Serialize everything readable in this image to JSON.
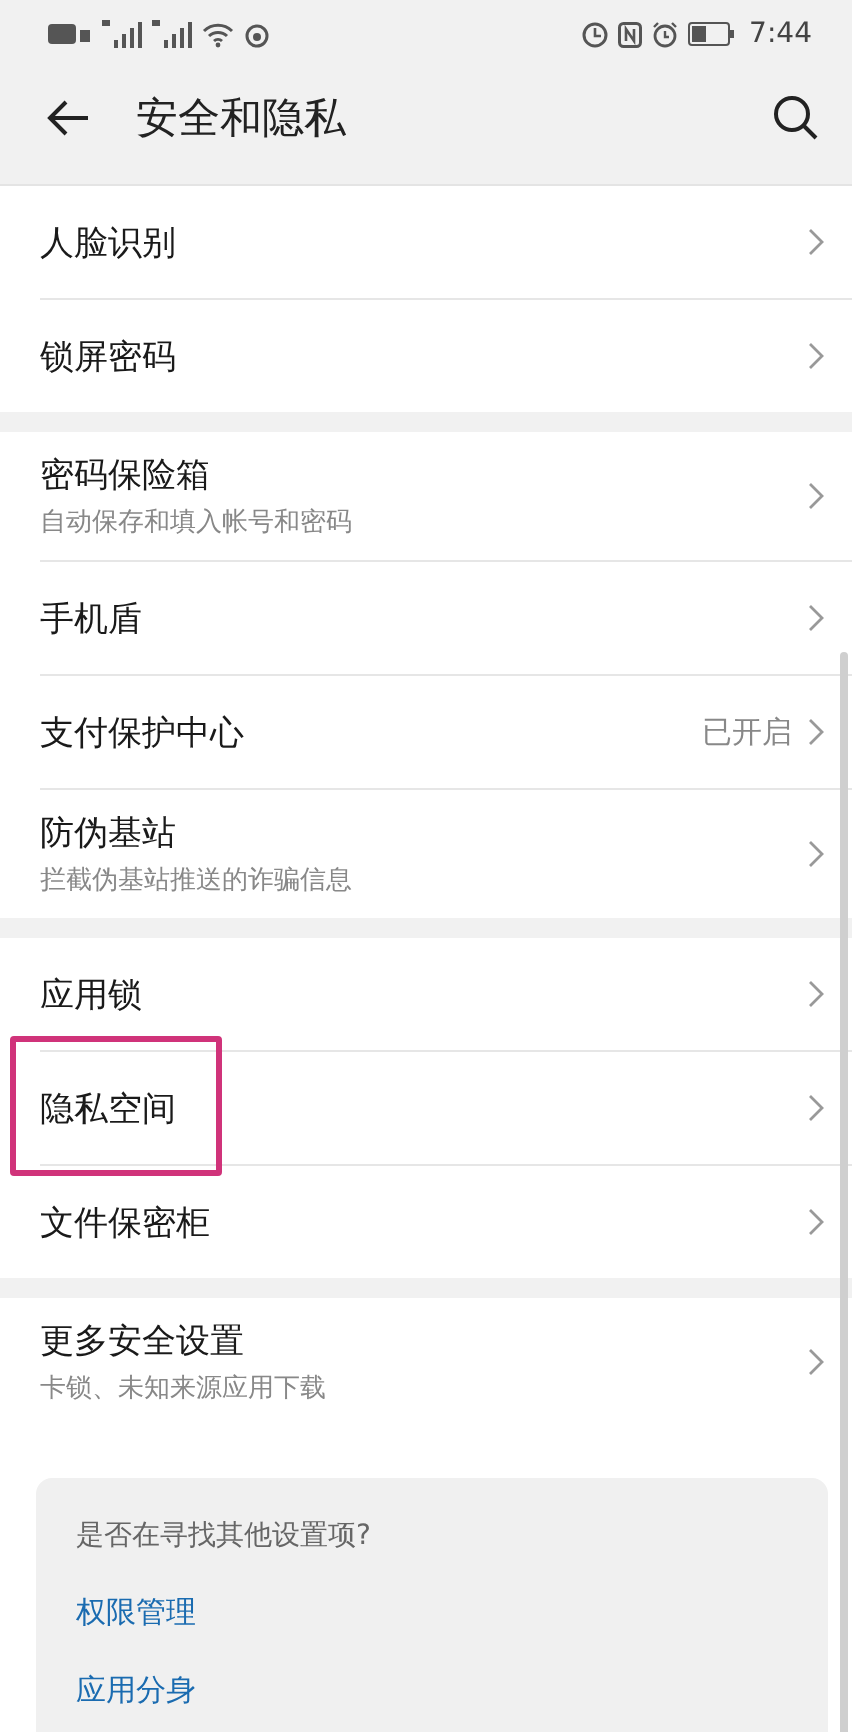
{
  "status_bar": {
    "time": "7:44"
  },
  "header": {
    "title": "安全和隐私"
  },
  "groups": [
    {
      "items": [
        {
          "title": "人脸识别",
          "highlighted": false
        },
        {
          "title": "锁屏密码",
          "highlighted": false
        }
      ]
    },
    {
      "items": [
        {
          "title": "密码保险箱",
          "subtitle": "自动保存和填入帐号和密码",
          "highlighted": false
        },
        {
          "title": "手机盾",
          "highlighted": false
        },
        {
          "title": "支付保护中心",
          "value": "已开启",
          "highlighted": false
        },
        {
          "title": "防伪基站",
          "subtitle": "拦截伪基站推送的诈骗信息",
          "highlighted": false
        }
      ]
    },
    {
      "items": [
        {
          "title": "应用锁",
          "highlighted": false
        },
        {
          "title": "隐私空间",
          "highlighted": true
        },
        {
          "title": "文件保密柜",
          "highlighted": false
        }
      ]
    },
    {
      "items": [
        {
          "title": "更多安全设置",
          "subtitle": "卡锁、未知来源应用下载",
          "highlighted": false
        }
      ]
    }
  ],
  "suggestions": {
    "question": "是否在寻找其他设置项?",
    "links": [
      "权限管理",
      "应用分身"
    ]
  }
}
